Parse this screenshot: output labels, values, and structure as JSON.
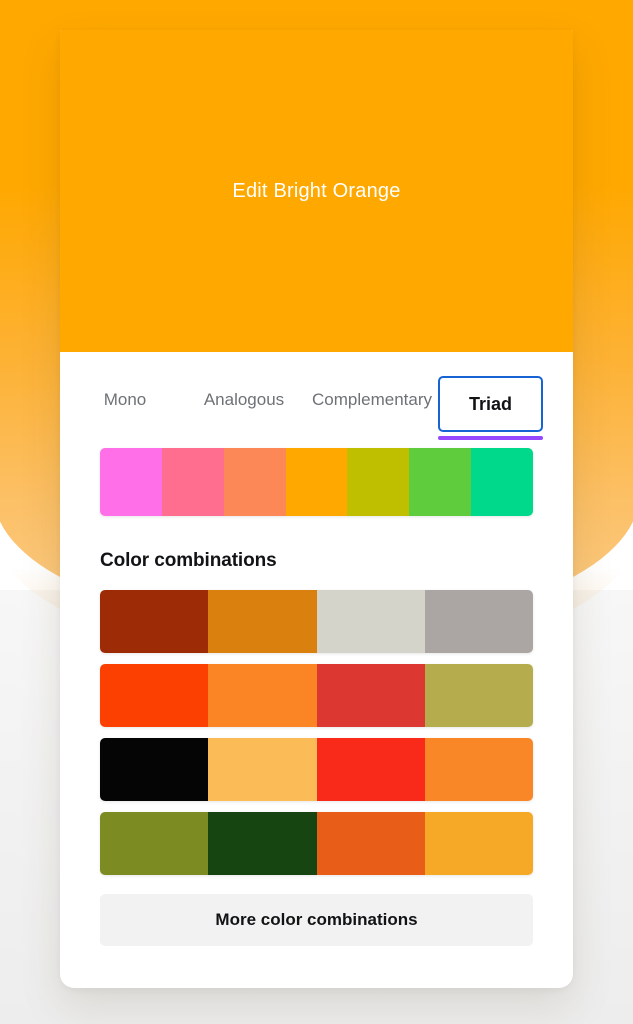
{
  "theme": {
    "brand_orange": "#FFA800",
    "focus_blue": "#1763D4",
    "underline_purple": "#9747FF",
    "text_dark": "#111315",
    "text_muted": "#6E7276",
    "button_grey": "#F2F2F2"
  },
  "hero": {
    "title": "Edit Bright Orange"
  },
  "tabs": [
    {
      "label": "Mono",
      "selected": false
    },
    {
      "label": "Analogous",
      "selected": false
    },
    {
      "label": "Complementary",
      "selected": false
    },
    {
      "label": "Triad",
      "selected": true
    }
  ],
  "palette": {
    "name": "Triad palette",
    "swatches": [
      {
        "hex": "#FF6FE8",
        "name": "bright-pink"
      },
      {
        "hex": "#FF6E8E",
        "name": "pink-red"
      },
      {
        "hex": "#FC8757",
        "name": "coral-orange"
      },
      {
        "hex": "#FFA800",
        "name": "bright-orange"
      },
      {
        "hex": "#BFBF00",
        "name": "olive-yellow"
      },
      {
        "hex": "#5FCC3E",
        "name": "green"
      },
      {
        "hex": "#00D98B",
        "name": "spring-green"
      }
    ]
  },
  "combinations_section": {
    "heading": "Color combinations",
    "rows": [
      {
        "colors": [
          "#9C2B06",
          "#D9800F",
          "#D4D4CA",
          "#ABA6A4"
        ]
      },
      {
        "colors": [
          "#FC4001",
          "#FB8425",
          "#DC3730",
          "#B5AC4E"
        ]
      },
      {
        "colors": [
          "#050505",
          "#FBBC58",
          "#F92A1A",
          "#F98727"
        ]
      },
      {
        "colors": [
          "#7C8B22",
          "#174511",
          "#E85D18",
          "#F5A927"
        ]
      }
    ],
    "more_button_label": "More color combinations"
  }
}
